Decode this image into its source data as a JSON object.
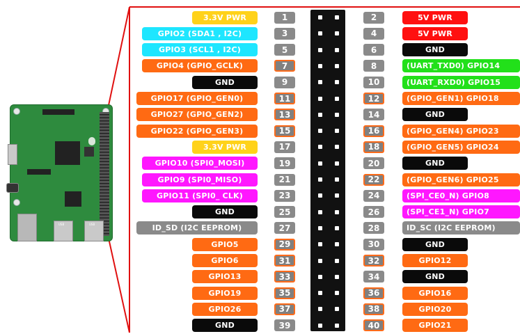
{
  "diagram": {
    "board": {
      "usb_labels": [
        "USB",
        "USB"
      ]
    },
    "left_pins": [
      {
        "num": "1",
        "label": "3.3V PWR",
        "color": "yellow",
        "num_style": "grey"
      },
      {
        "num": "3",
        "label": "GPIO2 (SDA1 , I2C)",
        "color": "cyan",
        "num_style": "grey"
      },
      {
        "num": "5",
        "label": "GPIO3 (SCL1 , I2C)",
        "color": "cyan",
        "num_style": "grey"
      },
      {
        "num": "7",
        "label": "GPIO4 (GPIO_GCLK)",
        "color": "orange",
        "num_style": "orange"
      },
      {
        "num": "9",
        "label": "GND",
        "color": "black",
        "num_style": "grey"
      },
      {
        "num": "11",
        "label": "GPIO17 (GPIO_GEN0)",
        "color": "orange",
        "num_style": "orange"
      },
      {
        "num": "13",
        "label": "GPIO27 (GPIO_GEN2)",
        "color": "orange",
        "num_style": "orange"
      },
      {
        "num": "15",
        "label": "GPIO22 (GPIO_GEN3)",
        "color": "orange",
        "num_style": "orange"
      },
      {
        "num": "17",
        "label": "3.3V PWR",
        "color": "yellow",
        "num_style": "grey"
      },
      {
        "num": "19",
        "label": "GPIO10 (SPI0_MOSI)",
        "color": "magenta",
        "num_style": "grey"
      },
      {
        "num": "21",
        "label": "GPIO9 (SPI0_MISO)",
        "color": "magenta",
        "num_style": "grey"
      },
      {
        "num": "23",
        "label": "GPIO11 (SPI0_ CLK)",
        "color": "magenta",
        "num_style": "grey"
      },
      {
        "num": "25",
        "label": "GND",
        "color": "black",
        "num_style": "grey"
      },
      {
        "num": "27",
        "label": "ID_SD (I2C EEPROM)",
        "color": "grey",
        "num_style": "grey"
      },
      {
        "num": "29",
        "label": "GPIO5",
        "color": "orange",
        "num_style": "orange"
      },
      {
        "num": "31",
        "label": "GPIO6",
        "color": "orange",
        "num_style": "orange"
      },
      {
        "num": "33",
        "label": "GPIO13",
        "color": "orange",
        "num_style": "orange"
      },
      {
        "num": "35",
        "label": "GPIO19",
        "color": "orange",
        "num_style": "orange"
      },
      {
        "num": "37",
        "label": "GPIO26",
        "color": "orange",
        "num_style": "orange"
      },
      {
        "num": "39",
        "label": "GND",
        "color": "black",
        "num_style": "grey"
      }
    ],
    "right_pins": [
      {
        "num": "2",
        "label": "5V PWR",
        "color": "red",
        "num_style": "grey"
      },
      {
        "num": "4",
        "label": "5V PWR",
        "color": "red",
        "num_style": "grey"
      },
      {
        "num": "6",
        "label": "GND",
        "color": "black",
        "num_style": "grey"
      },
      {
        "num": "8",
        "label": "(UART_TXD0) GPIO14",
        "color": "green",
        "num_style": "grey"
      },
      {
        "num": "10",
        "label": "(UART_RXD0) GPIO15",
        "color": "green",
        "num_style": "grey"
      },
      {
        "num": "12",
        "label": "(GPIO_GEN1) GPIO18",
        "color": "orange",
        "num_style": "orange"
      },
      {
        "num": "14",
        "label": "GND",
        "color": "black",
        "num_style": "grey"
      },
      {
        "num": "16",
        "label": "(GPIO_GEN4) GPIO23",
        "color": "orange",
        "num_style": "orange"
      },
      {
        "num": "18",
        "label": "(GPIO_GEN5) GPIO24",
        "color": "orange",
        "num_style": "orange"
      },
      {
        "num": "20",
        "label": "GND",
        "color": "black",
        "num_style": "grey"
      },
      {
        "num": "22",
        "label": "(GPIO_GEN6) GPIO25",
        "color": "orange",
        "num_style": "orange"
      },
      {
        "num": "24",
        "label": "(SPI_CE0_N) GPIO8",
        "color": "magenta",
        "num_style": "grey"
      },
      {
        "num": "26",
        "label": "(SPI_CE1_N) GPIO7",
        "color": "magenta",
        "num_style": "grey"
      },
      {
        "num": "28",
        "label": "ID_SC (I2C EEPROM)",
        "color": "grey",
        "num_style": "grey"
      },
      {
        "num": "30",
        "label": "GND",
        "color": "black",
        "num_style": "grey"
      },
      {
        "num": "32",
        "label": "GPIO12",
        "color": "orange",
        "num_style": "orange"
      },
      {
        "num": "34",
        "label": "GND",
        "color": "black",
        "num_style": "grey"
      },
      {
        "num": "36",
        "label": "GPIO16",
        "color": "orange",
        "num_style": "orange"
      },
      {
        "num": "38",
        "label": "GPIO20",
        "color": "orange",
        "num_style": "orange"
      },
      {
        "num": "40",
        "label": "GPIO21",
        "color": "orange",
        "num_style": "orange"
      }
    ],
    "colors": {
      "yellow": "#ffd21a",
      "cyan": "#1ee6ff",
      "orange": "#ff6a13",
      "black": "#0a0a0a",
      "magenta": "#ff17ff",
      "grey": "#8a8a8a",
      "red": "#ff1010",
      "green": "#22e01a",
      "zoom_frame": "#e01010",
      "board": "#2e8b3e"
    }
  }
}
